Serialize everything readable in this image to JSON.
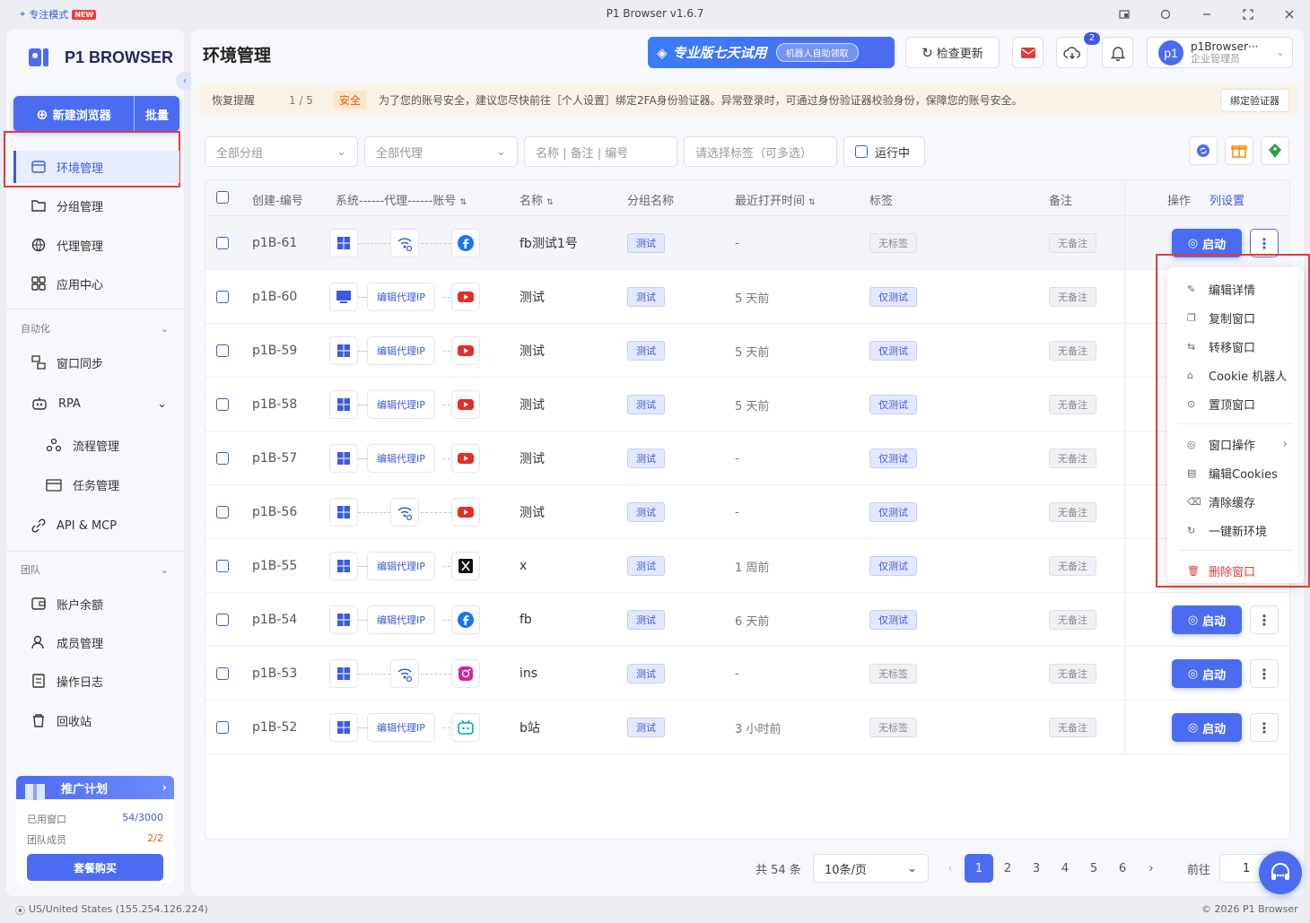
{
  "titlebar": {
    "focus_mode": "专注模式",
    "new_badge": "NEW",
    "title": "P1 Browser v1.6.7"
  },
  "sidebar": {
    "logo": "P1 BROWSER",
    "new_browser": "新建浏览器",
    "batch": "批量",
    "items": [
      {
        "label": "环境管理",
        "icon": "window-icon"
      },
      {
        "label": "分组管理",
        "icon": "folder-icon"
      },
      {
        "label": "代理管理",
        "icon": "globe-icon"
      },
      {
        "label": "应用中心",
        "icon": "grid-icon"
      }
    ],
    "automation": {
      "title": "自动化",
      "items": [
        {
          "label": "窗口同步"
        },
        {
          "label": "RPA"
        },
        {
          "label": "流程管理"
        },
        {
          "label": "任务管理"
        },
        {
          "label": "API & MCP"
        }
      ]
    },
    "team": {
      "title": "团队",
      "items": [
        {
          "label": "账户余额"
        },
        {
          "label": "成员管理"
        },
        {
          "label": "操作日志"
        },
        {
          "label": "回收站"
        }
      ]
    },
    "promo": {
      "title": "推广计划",
      "used_windows_label": "已用窗口",
      "used_windows_value": "54/3000",
      "team_members_label": "团队成员",
      "team_members_value": "2/2",
      "buy": "套餐购买"
    }
  },
  "header": {
    "title": "环境管理",
    "trial": "专业版七天试用",
    "trial_chip": "机器人自助领取",
    "check_update": "检查更新",
    "download_count": "2",
    "user_name": "p1Browser···",
    "user_role": "企业管理员",
    "avatar": "p1"
  },
  "notice": {
    "recover": "恢复提醒",
    "page": "1 / 5",
    "tag": "安全",
    "message": "为了您的账号安全，建议您尽快前往［个人设置］绑定2FA身份验证器。异常登录时，可通过身份验证器校验身份，保障您的账号安全。",
    "bind": "绑定验证器"
  },
  "filters": {
    "group": "全部分组",
    "proxy": "全部代理",
    "search_placeholder": "名称 | 备注 | 编号",
    "tags_placeholder": "请选择标签（可多选）",
    "running": "运行中"
  },
  "table": {
    "headers": {
      "id": "创建-编号",
      "system": "系统------代理------账号",
      "name": "名称",
      "group": "分组名称",
      "last_open": "最近打开时间",
      "tags": "标签",
      "note": "备注",
      "ops": "操作",
      "col_settings": "列设置"
    },
    "start_label": "启动",
    "edit_proxy_label": "编辑代理IP",
    "rows": [
      {
        "id": "p1B-61",
        "sys": "windows",
        "proxy": "direct",
        "account": "facebook",
        "name": "fb测试1号",
        "group": "测试",
        "last": "-",
        "tag": "无标签",
        "tag_on": false,
        "note": "无备注"
      },
      {
        "id": "p1B-60",
        "sys": "monitor",
        "proxy": "edit",
        "account": "youtube",
        "name": "测试",
        "group": "测试",
        "last": "5 天前",
        "tag": "仅测试",
        "tag_on": true,
        "note": "无备注"
      },
      {
        "id": "p1B-59",
        "sys": "windows",
        "proxy": "edit",
        "account": "youtube",
        "name": "测试",
        "group": "测试",
        "last": "5 天前",
        "tag": "仅测试",
        "tag_on": true,
        "note": "无备注"
      },
      {
        "id": "p1B-58",
        "sys": "windows",
        "proxy": "edit",
        "account": "youtube",
        "name": "测试",
        "group": "测试",
        "last": "5 天前",
        "tag": "仅测试",
        "tag_on": true,
        "note": "无备注"
      },
      {
        "id": "p1B-57",
        "sys": "windows",
        "proxy": "edit",
        "account": "youtube",
        "name": "测试",
        "group": "测试",
        "last": "-",
        "tag": "仅测试",
        "tag_on": true,
        "note": "无备注"
      },
      {
        "id": "p1B-56",
        "sys": "windows",
        "proxy": "direct",
        "account": "youtube",
        "name": "测试",
        "group": "测试",
        "last": "-",
        "tag": "仅测试",
        "tag_on": true,
        "note": "无备注"
      },
      {
        "id": "p1B-55",
        "sys": "windows",
        "proxy": "edit",
        "account": "x",
        "name": "x",
        "group": "测试",
        "last": "1 周前",
        "tag": "仅测试",
        "tag_on": true,
        "note": "无备注"
      },
      {
        "id": "p1B-54",
        "sys": "windows",
        "proxy": "edit",
        "account": "facebook",
        "name": "fb",
        "group": "测试",
        "last": "6 天前",
        "tag": "仅测试",
        "tag_on": true,
        "note": "无备注"
      },
      {
        "id": "p1B-53",
        "sys": "windows",
        "proxy": "direct",
        "account": "instagram",
        "name": "ins",
        "group": "测试",
        "last": "-",
        "tag": "无标签",
        "tag_on": false,
        "note": "无备注"
      },
      {
        "id": "p1B-52",
        "sys": "windows",
        "proxy": "edit",
        "account": "bilibili",
        "name": "b站",
        "group": "测试",
        "last": "3 小时前",
        "tag": "无标签",
        "tag_on": false,
        "note": "无备注"
      }
    ]
  },
  "context_menu": [
    {
      "label": "编辑详情",
      "icon": "edit-icon"
    },
    {
      "label": "复制窗口",
      "icon": "copy-icon"
    },
    {
      "label": "转移窗口",
      "icon": "transfer-icon"
    },
    {
      "label": "Cookie 机器人",
      "icon": "robot-icon"
    },
    {
      "label": "置顶窗口",
      "icon": "pin-top-icon"
    },
    {
      "label": "窗口操作",
      "icon": "window-ops-icon",
      "submenu": true,
      "sep_before": true
    },
    {
      "label": "编辑Cookies",
      "icon": "cookie-icon"
    },
    {
      "label": "清除缓存",
      "icon": "clear-icon"
    },
    {
      "label": "一键新环境",
      "icon": "refresh-icon"
    },
    {
      "label": "删除窗口",
      "icon": "trash-icon",
      "danger": true,
      "sep_before": true
    }
  ],
  "pager": {
    "total": "共 54 条",
    "page_size": "10条/页",
    "pages": [
      "1",
      "2",
      "3",
      "4",
      "5",
      "6"
    ],
    "current": "1",
    "goto_label": "前往",
    "goto_value": "1"
  },
  "footer": {
    "location": "US/United States (155.254.126.224)",
    "copyright": "© 2026 P1 Browser"
  },
  "colors": {
    "accent": "#4b6cf0",
    "danger": "#e03c3c",
    "highlight_box": "#e03c3c"
  }
}
